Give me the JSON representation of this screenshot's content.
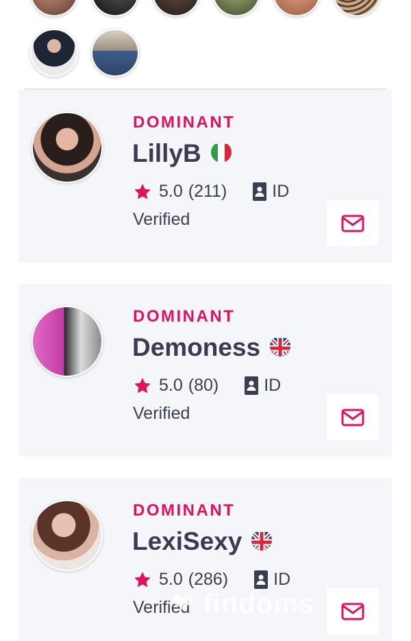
{
  "stories": {
    "row1": [
      "story-1",
      "story-2",
      "story-3",
      "story-4",
      "story-5",
      "story-6"
    ],
    "row2": [
      "story-7",
      "story-8"
    ]
  },
  "profiles": [
    {
      "role": "DOMINANT",
      "name": "LillyB",
      "flag": "italy-flag",
      "rating": "5.0",
      "reviews": "(211)",
      "id_label": "ID",
      "verified": "Verified",
      "message_icon": "envelope-icon"
    },
    {
      "role": "DOMINANT",
      "name": "Demoness",
      "flag": "uk-flag",
      "rating": "5.0",
      "reviews": "(80)",
      "id_label": "ID",
      "verified": "Verified",
      "message_icon": "envelope-icon"
    },
    {
      "role": "DOMINANT",
      "name": "LexiSexy",
      "flag": "uk-flag",
      "rating": "5.0",
      "reviews": "(286)",
      "id_label": "ID",
      "verified": "Verified",
      "message_icon": "envelope-icon"
    }
  ],
  "watermark": "findoms",
  "colors": {
    "accent": "#e0125f",
    "text": "#3b3a52",
    "card": "#f5f6f9"
  }
}
